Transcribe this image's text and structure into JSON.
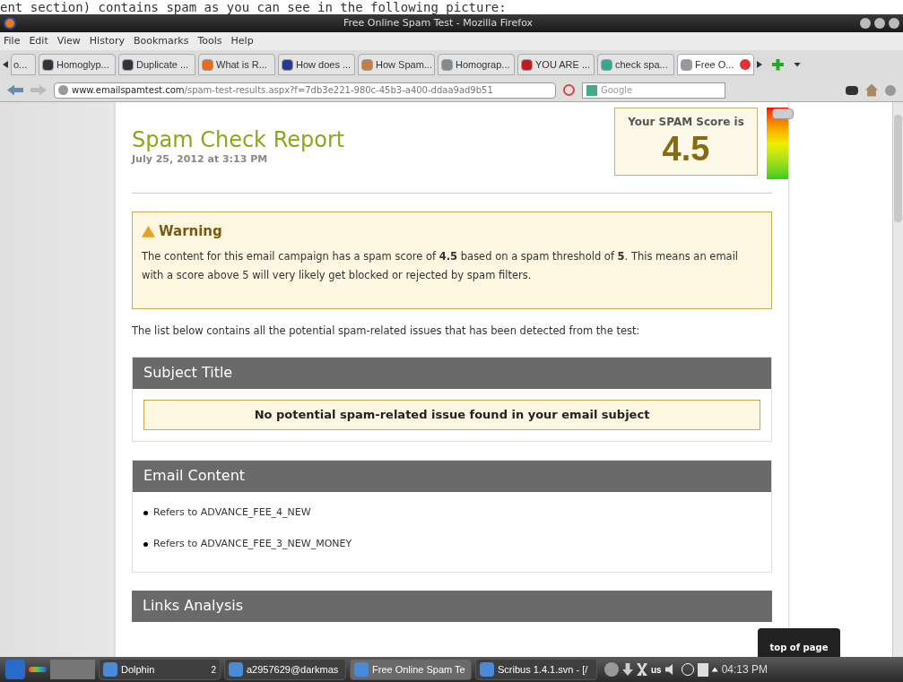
{
  "caption": "ent section) contains spam as you can see in the following picture:",
  "window": {
    "title": "Free Online Spam Test - Mozilla Firefox"
  },
  "menu": [
    "File",
    "Edit",
    "View",
    "History",
    "Bookmarks",
    "Tools",
    "Help"
  ],
  "tabs": [
    {
      "label": "o...",
      "selected": false
    },
    {
      "label": "Homoglyp...",
      "selected": false
    },
    {
      "label": "Duplicate ...",
      "selected": false
    },
    {
      "label": "What is R...",
      "selected": false
    },
    {
      "label": "How does ...",
      "selected": false
    },
    {
      "label": "How Spam...",
      "selected": false
    },
    {
      "label": "Homograp...",
      "selected": false
    },
    {
      "label": "YOU ARE ...",
      "selected": false
    },
    {
      "label": "check spa...",
      "selected": false
    },
    {
      "label": "Free O...",
      "selected": true
    }
  ],
  "address": {
    "domain": "www.emailspamtest.com",
    "path": "/spam-test-results.aspx?f=7db3e221-980c-45b3-a400-ddaa9ad9b51"
  },
  "search": {
    "placeholder": "Google"
  },
  "report": {
    "title": "Spam Check Report",
    "date": "July 25, 2012 at 3:13 PM",
    "score_label": "Your SPAM Score is",
    "score": "4.5",
    "meter": {
      "level": 0.9
    },
    "warning": {
      "title": "Warning",
      "text": "The content for this email campaign has a spam score of **4.5** based on a spam threshold of **5**. This means an email with a score above 5 will very likely get blocked or rejected by spam filters."
    },
    "intro": "The list below contains all the potential spam-related issues that has been detected from the test:",
    "sections": [
      {
        "title": "Subject Title",
        "kind": "notice",
        "notice": "No potential spam-related issue found in your email subject"
      },
      {
        "title": "Email Content",
        "kind": "list",
        "items": [
          "Refers to ADVANCE_FEE_4_NEW",
          "Refers to ADVANCE_FEE_3_NEW_MONEY"
        ]
      },
      {
        "title": "Links Analysis",
        "kind": "header"
      }
    ]
  },
  "top_button": "top of page",
  "taskbar": {
    "tasks": [
      {
        "label": "Dolphin",
        "badge": "2",
        "selected": false
      },
      {
        "label": "a2957629@darkmas",
        "selected": false
      },
      {
        "label": "Free Online Spam Te",
        "selected": true
      },
      {
        "label": "Scribus 1.4.1.svn - [/",
        "selected": false
      }
    ],
    "keyboard": "us",
    "clock": "04:13 PM"
  }
}
